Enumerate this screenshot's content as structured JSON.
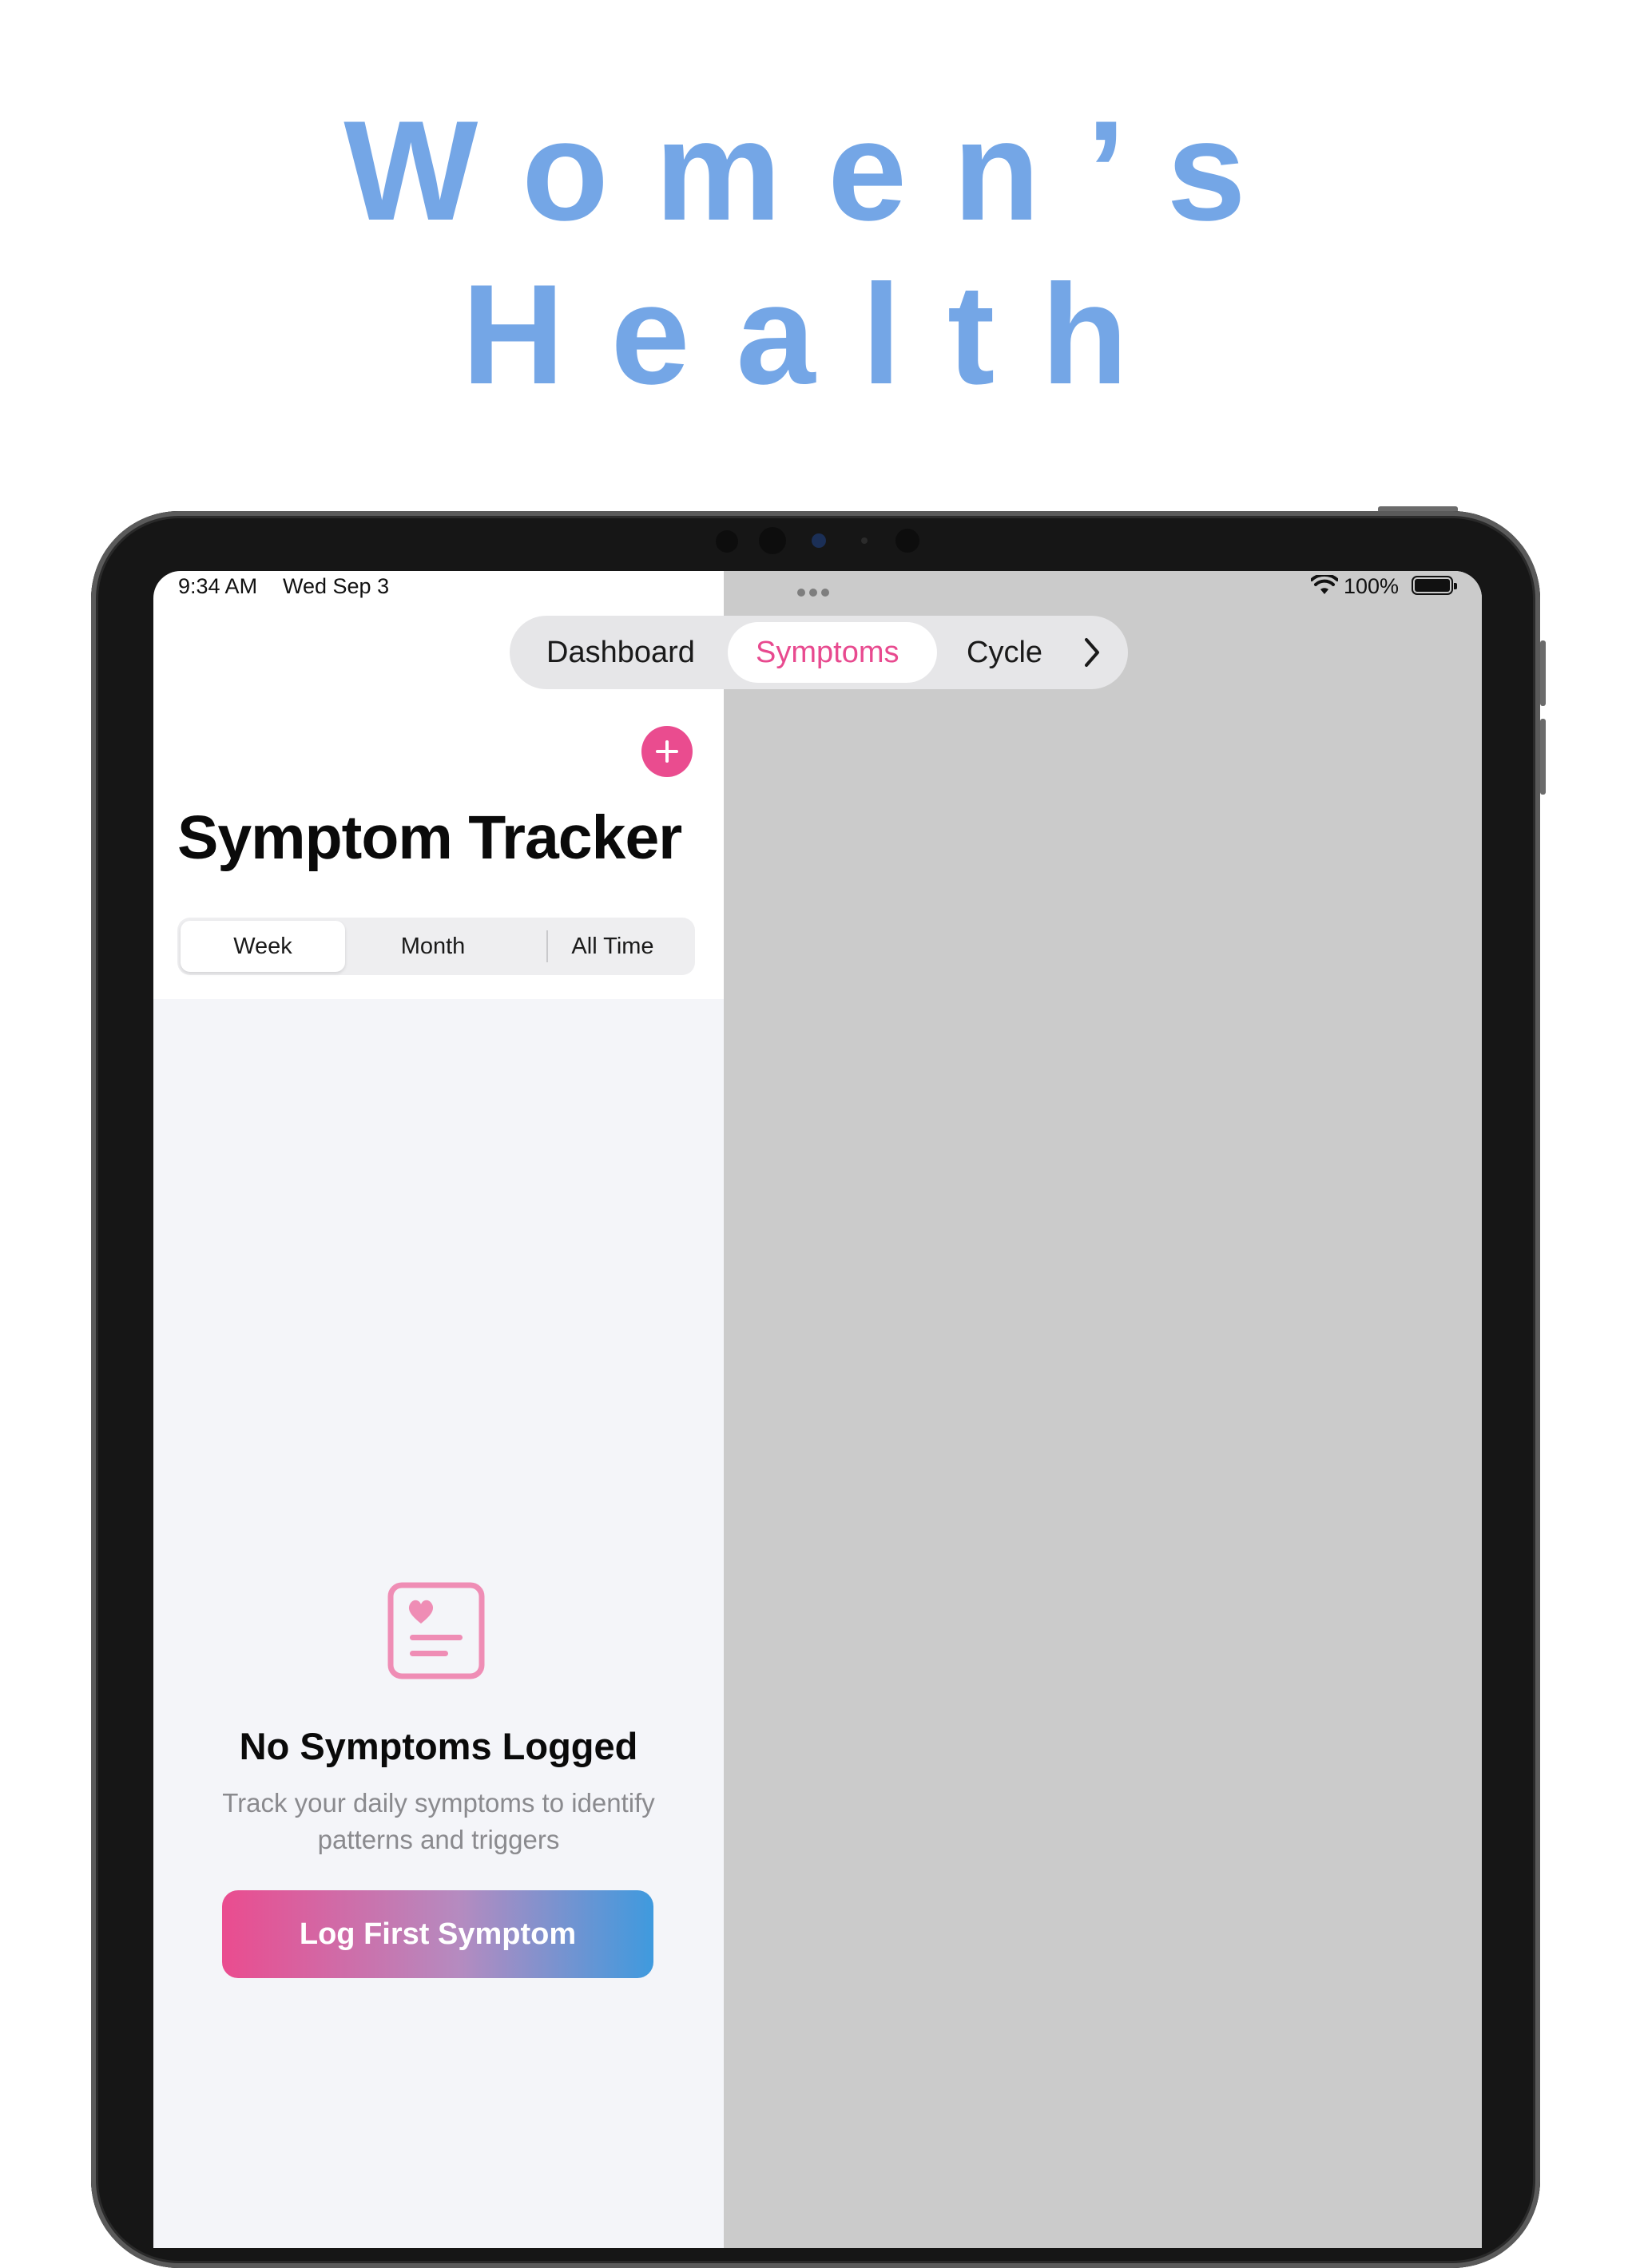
{
  "headline": {
    "line1": "Women’s",
    "line2": "Health"
  },
  "status_bar": {
    "time": "9:34 AM",
    "date": "Wed Sep 3",
    "battery": "100%",
    "wifi_icon": "wifi-icon",
    "battery_icon": "battery-icon"
  },
  "tabs": {
    "items": [
      "Dashboard",
      "Symptoms",
      "Cycle"
    ],
    "selected": "Symptoms",
    "more_icon": "chevron-right-icon"
  },
  "symptoms": {
    "title": "Symptom Tracker",
    "add_icon": "plus-icon",
    "ranges": [
      "Week",
      "Month",
      "All Time"
    ],
    "selected_range": "Week",
    "empty": {
      "icon": "heart-card-icon",
      "title": "No Symptoms Logged",
      "description": "Track your daily symptoms to identify patterns and triggers",
      "button": "Log First Symptom"
    }
  },
  "colors": {
    "headline": "#74a6e6",
    "accent": "#ea4c8f",
    "button_gradient_start": "#ea4c8f",
    "button_gradient_end": "#3f9ade",
    "detail_pane": "#cbcbcb"
  }
}
